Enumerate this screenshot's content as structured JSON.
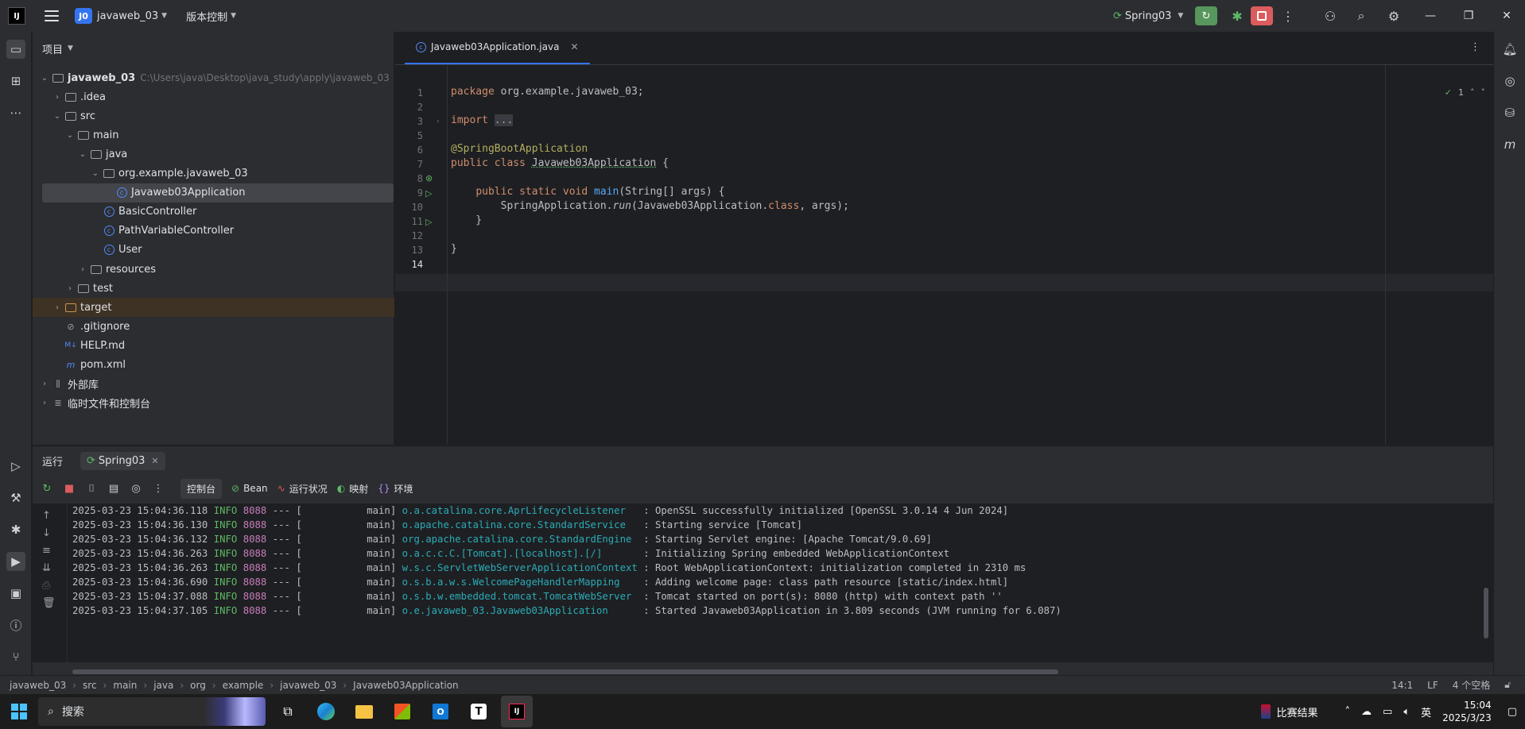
{
  "titlebar": {
    "logo": "IJ",
    "project_badge": "J0",
    "project_name": "javaweb_03",
    "vcs_label": "版本控制",
    "run_config": "Spring03"
  },
  "project_panel": {
    "title": "项目",
    "tree": [
      {
        "label": "javaweb_03",
        "hint": "C:\\Users\\java\\Desktop\\java_study\\apply\\javaweb_03",
        "indent": 0,
        "arrow": "open",
        "icon": "folder"
      },
      {
        "label": ".idea",
        "indent": 1,
        "arrow": "closed",
        "icon": "folder"
      },
      {
        "label": "src",
        "indent": 1,
        "arrow": "open",
        "icon": "folder"
      },
      {
        "label": "main",
        "indent": 2,
        "arrow": "open",
        "icon": "folder"
      },
      {
        "label": "java",
        "indent": 3,
        "arrow": "open",
        "icon": "folder"
      },
      {
        "label": "org.example.javaweb_03",
        "indent": 4,
        "arrow": "open",
        "icon": "folder"
      },
      {
        "label": "Javaweb03Application",
        "indent": 5,
        "arrow": "",
        "icon": "class",
        "selected": true
      },
      {
        "label": "BasicController",
        "indent": 4,
        "arrow": "",
        "icon": "class"
      },
      {
        "label": "PathVariableController",
        "indent": 4,
        "arrow": "",
        "icon": "class"
      },
      {
        "label": "User",
        "indent": 4,
        "arrow": "",
        "icon": "class"
      },
      {
        "label": "resources",
        "indent": 3,
        "arrow": "closed",
        "icon": "folder"
      },
      {
        "label": "test",
        "indent": 2,
        "arrow": "closed",
        "icon": "folder"
      },
      {
        "label": "target",
        "indent": 1,
        "arrow": "closed",
        "icon": "folder-orange",
        "highlight": true
      },
      {
        "label": ".gitignore",
        "indent": 1,
        "arrow": "",
        "icon": "ignore"
      },
      {
        "label": "HELP.md",
        "indent": 1,
        "arrow": "",
        "icon": "md"
      },
      {
        "label": "pom.xml",
        "indent": 1,
        "arrow": "",
        "icon": "maven"
      },
      {
        "label": "外部库",
        "indent": 0,
        "arrow": "closed",
        "icon": "lib"
      },
      {
        "label": "临时文件和控制台",
        "indent": 0,
        "arrow": "closed",
        "icon": "scratch"
      }
    ]
  },
  "editor": {
    "tab_label": "Javaweb03Application.java",
    "inspection_count": "1",
    "line_numbers": [
      "1",
      "2",
      "3",
      "5",
      "6",
      "7",
      "8",
      "9",
      "10",
      "11",
      "12",
      "13",
      "14"
    ]
  },
  "run_panel": {
    "tab_run": "运行",
    "tab_config": "Spring03",
    "toolbar": {
      "console": "控制台",
      "bean": "Bean",
      "health": "运行状况",
      "mappings": "映射",
      "env": "环境"
    },
    "logs": [
      {
        "ts": "2025-03-23 15:04:36.118",
        "level": "INFO",
        "pid": "8088",
        "sep": "--- [",
        "thread": "main]",
        "logger": "o.a.catalina.core.AprLifecycleListener",
        "msg": ": OpenSSL successfully initialized [OpenSSL 3.0.14 4 Jun 2024]"
      },
      {
        "ts": "2025-03-23 15:04:36.130",
        "level": "INFO",
        "pid": "8088",
        "sep": "--- [",
        "thread": "main]",
        "logger": "o.apache.catalina.core.StandardService",
        "msg": ": Starting service [Tomcat]"
      },
      {
        "ts": "2025-03-23 15:04:36.132",
        "level": "INFO",
        "pid": "8088",
        "sep": "--- [",
        "thread": "main]",
        "logger": "org.apache.catalina.core.StandardEngine",
        "msg": ": Starting Servlet engine: [Apache Tomcat/9.0.69]"
      },
      {
        "ts": "2025-03-23 15:04:36.263",
        "level": "INFO",
        "pid": "8088",
        "sep": "--- [",
        "thread": "main]",
        "logger": "o.a.c.c.C.[Tomcat].[localhost].[/]",
        "msg": ": Initializing Spring embedded WebApplicationContext"
      },
      {
        "ts": "2025-03-23 15:04:36.263",
        "level": "INFO",
        "pid": "8088",
        "sep": "--- [",
        "thread": "main]",
        "logger": "w.s.c.ServletWebServerApplicationContext",
        "msg": ": Root WebApplicationContext: initialization completed in 2310 ms"
      },
      {
        "ts": "2025-03-23 15:04:36.690",
        "level": "INFO",
        "pid": "8088",
        "sep": "--- [",
        "thread": "main]",
        "logger": "o.s.b.a.w.s.WelcomePageHandlerMapping",
        "msg": ": Adding welcome page: class path resource [static/index.html]"
      },
      {
        "ts": "2025-03-23 15:04:37.088",
        "level": "INFO",
        "pid": "8088",
        "sep": "--- [",
        "thread": "main]",
        "logger": "o.s.b.w.embedded.tomcat.TomcatWebServer",
        "msg": ": Tomcat started on port(s): 8080 (http) with context path ''"
      },
      {
        "ts": "2025-03-23 15:04:37.105",
        "level": "INFO",
        "pid": "8088",
        "sep": "--- [",
        "thread": "main]",
        "logger": "o.e.javaweb_03.Javaweb03Application",
        "msg": ": Started Javaweb03Application in 3.809 seconds (JVM running for 6.087)"
      }
    ]
  },
  "statusbar": {
    "breadcrumbs": [
      "javaweb_03",
      "src",
      "main",
      "java",
      "org",
      "example",
      "javaweb_03",
      "Javaweb03Application"
    ],
    "position": "14:1",
    "line_sep": "LF",
    "indent": "4 个空格"
  },
  "taskbar": {
    "search_placeholder": "搜索",
    "news": "比赛结果",
    "ime": "英",
    "time": "15:04",
    "date": "2025/3/23"
  }
}
